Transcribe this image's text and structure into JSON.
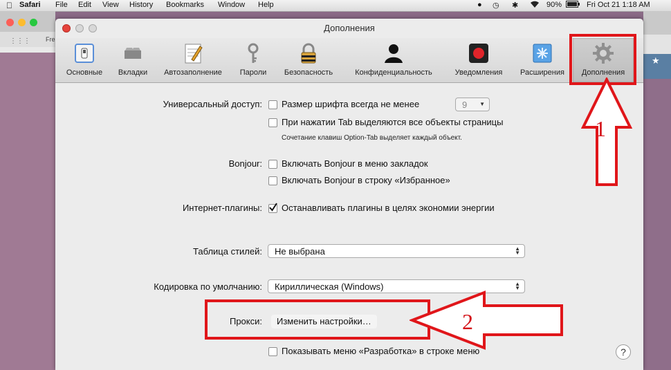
{
  "menubar": {
    "items": [
      "Safari",
      "File",
      "Edit",
      "View",
      "History",
      "Bookmarks",
      "Window",
      "Help"
    ],
    "battery": "90%",
    "datetime": "Fri Oct 21  1:18 AM"
  },
  "background_window": {
    "fav_text": "Fre"
  },
  "window": {
    "title": "Дополнения",
    "tabs": [
      {
        "label": "Основные",
        "icon": "general-switch-icon"
      },
      {
        "label": "Вкладки",
        "icon": "tabs-icon"
      },
      {
        "label": "Автозаполнение",
        "icon": "autofill-pencil-icon"
      },
      {
        "label": "Пароли",
        "icon": "key-icon"
      },
      {
        "label": "Безопасность",
        "icon": "lock-icon"
      },
      {
        "label": "Конфиденциальность",
        "icon": "person-silhouette-icon"
      },
      {
        "label": "Уведомления",
        "icon": "notification-record-icon"
      },
      {
        "label": "Расширения",
        "icon": "puzzle-extensions-icon"
      },
      {
        "label": "Дополнения",
        "icon": "gear-icon"
      }
    ],
    "active_tab": "Дополнения"
  },
  "settings": {
    "accessibility_label": "Универсальный доступ:",
    "min_font_label": "Размер шрифта всегда не менее",
    "min_font_value": "9",
    "tab_highlight_label": "При нажатии Tab выделяются все объекты страницы",
    "tab_note": "Сочетание клавиш Option-Tab выделяет каждый объект.",
    "bonjour_label": "Bonjour:",
    "bonjour_bookmarks_label": "Включать Bonjour в меню закладок",
    "bonjour_favorites_label": "Включать Bonjour в строку «Избранное»",
    "plugins_label": "Интернет-плагины:",
    "plugins_stop_label": "Останавливать плагины в целях экономии энергии",
    "stylesheet_label": "Таблица стилей:",
    "stylesheet_value": "Не выбрана",
    "encoding_label": "Кодировка по умолчанию:",
    "encoding_value": "Кириллическая (Windows)",
    "proxy_label": "Прокси:",
    "proxy_button": "Изменить настройки…",
    "develop_menu_label": "Показывать меню «Разработка» в строке меню",
    "help": "?"
  },
  "annotations": {
    "arrow1": "1",
    "arrow2": "2",
    "color": "#e0161a"
  }
}
